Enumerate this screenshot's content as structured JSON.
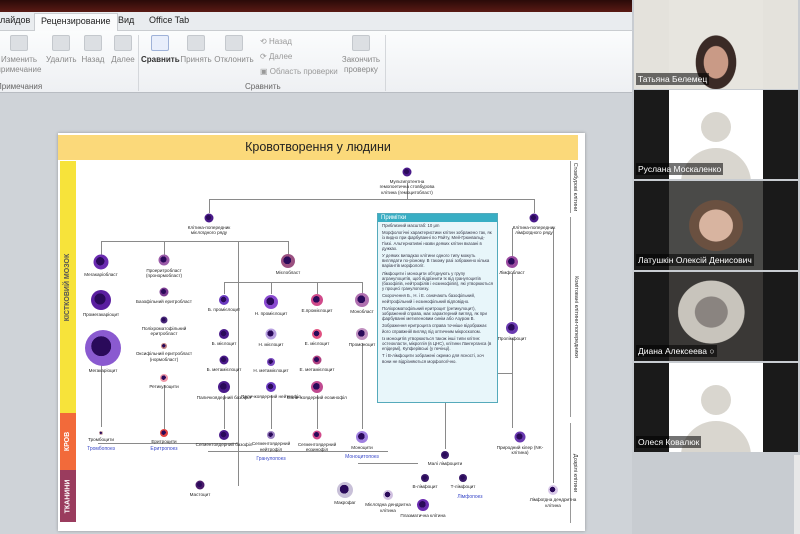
{
  "ribbon": {
    "tabs": [
      "лайдов",
      "Рецензирование",
      "Вид",
      "Office Tab"
    ],
    "buttons": {
      "edit_note": "Изменить примечание",
      "delete": "Удалить",
      "prev": "Назад",
      "next": "Далее",
      "compare": "Сравнить",
      "accept": "Принять",
      "reject": "Отклонить",
      "end_review": "Закончить проверку"
    },
    "small": {
      "back": "Назад",
      "forward": "Далее",
      "review_pane": "Область проверки"
    },
    "groups": {
      "notes": "Примечания",
      "compare": "Сравнить"
    }
  },
  "participants": [
    {
      "name": "Татьяна Белемец"
    },
    {
      "name": "Руслана Москаленко"
    },
    {
      "name": "Латушкін Олексій Денисович"
    },
    {
      "name": "Диана Алексеева"
    },
    {
      "name": "Олеся Ковалюк"
    }
  ],
  "slide": {
    "title": "Кровотворення у людини",
    "bands": [
      "КІСТКОВИЙ МОЗОК",
      "КРОВ",
      "ТКАНИНИ"
    ],
    "right_labels": [
      "Стовбурові клітини",
      "Комітовані клітини-попередники",
      "Дозрілі клітини"
    ],
    "cells": [
      "Мультипотентна гемопоетична стовбурова клітина (гемоцитобласт)",
      "Клітина-попередник мієлоїдного ряду",
      "Клітина-попередник лімфоїдного ряду",
      "Мегакаріобласт",
      "Промегакаріоцит",
      "Мегакаріоцит",
      "Проеритробласт (пронормобласт)",
      "Базофільний еритробласт",
      "Поліхроматофільний еритробласт",
      "Оксифільний еритробласт (нормобласт)",
      "Ретикулоцити",
      "Тромбоцити",
      "Еритроцити",
      "Мієлобласт",
      "Б. промієлоцит",
      "Н. промієлоцит",
      "Е.промієлоцит",
      "Монобласт",
      "Б. мієлоцит",
      "Н. мієлоцит",
      "Е. мієлоцит",
      "Промоноцит",
      "Б. метамієлоцит",
      "Н. метамієлоцит",
      "Е. метамієлоцит",
      "Паличкоядерний базофіл",
      "Паличкоядерний нейтрофіл",
      "Паличкоядерний еозинофіл",
      "Сегментоядерний базофіл",
      "Сегментоядерний нейтрофіл",
      "Сегментоядерний еозинофіл",
      "Моноцити",
      "Мастоцит",
      "Макрофаг",
      "Мієлоїдна дендритна клітина",
      "Лімфобласт",
      "Пролімфоцит",
      "Природний кілер (NK-клітина)",
      "Малі лімфоцити",
      "В-лімфоцит",
      "Т-лімфоцит",
      "Плазматична клітина",
      "Лімфоїдна дендритна клітина"
    ],
    "processes": [
      "Тромбопоез",
      "Еритропоез",
      "Гранулопоез",
      "Моноцитопоез",
      "Лімфопоез"
    ],
    "note": {
      "title": "Примітки",
      "paragraphs": [
        "Приблизний масштаб: 10 μm",
        "Морфологічні характеристики клітин зображено так, як із видно при фарбуванні по Райту, Мей-Грюнвальд-Гімзі. Альтернативні назви деяких клітин вказані в дужках.",
        "У деяких випадках клітини одного типу можуть виглядати по-різному. В такому разі зображено кілька варіантів морфології.",
        "Лімфоцити і моноцити об'єднують у групу агранулоцитів, щоб відрізнити їх від гранулоцитів (базофілів, нейтрофілів і еозинофілів), які утворюються у процесі гранулопоезу.",
        "Скорочення Б., Н. і Е. означають базофільний, нейтрофільний і еозинофільний відповідно.",
        "Поліхроматофільний еритроцит (ретикулоцит), зображений справа, має характерний вигляд, як при фарбуванні метиленовим синім або Азуром В.",
        "Зображення еритроцита справа точніше відображає його справжній вигляд під оптичним мікроскопом.",
        "Із моноцитів утворюються також інші типи клітин: остеокласти, мікроглія (в ЦНС), клітини Лангерганса (в епідермі), Купферівські (у печінці).",
        "Т і В-лімфоцити зображені окремо для ясності, хоч вони не відрізняються морфологічно."
      ]
    }
  },
  "colors": {
    "header": "#fbd97a",
    "bone_marrow": "#f7e33a",
    "blood": "#f26a3a",
    "tissue": "#9a3c5e",
    "note": "#38aec4",
    "process": "#3a49c9"
  }
}
